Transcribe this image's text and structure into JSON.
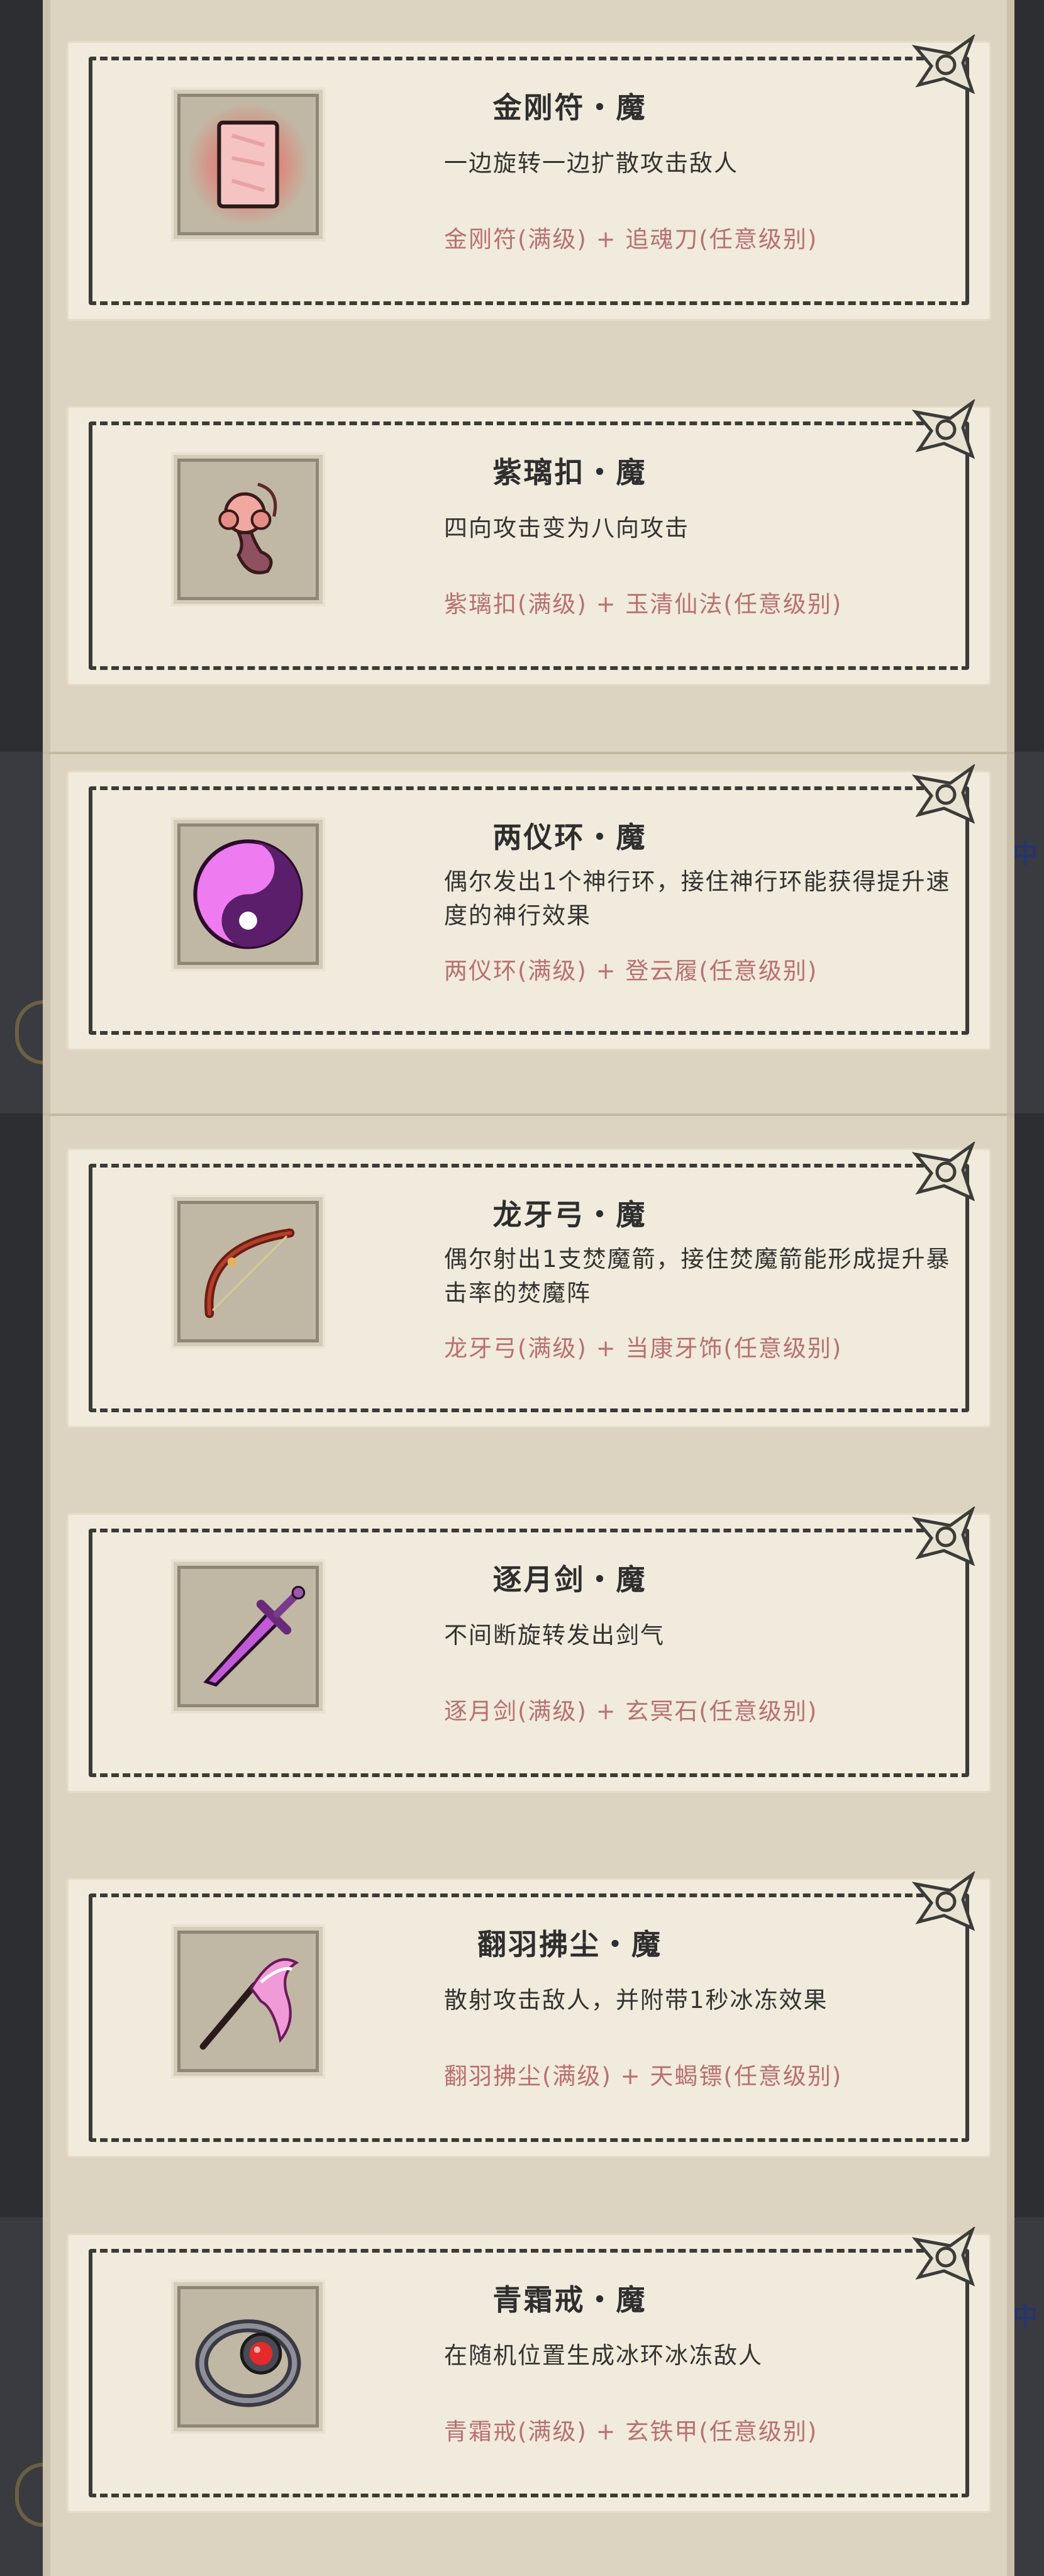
{
  "items": [
    {
      "title": "金刚符・魔",
      "desc": "一边旋转一边扩散攻击敌人",
      "recipe": "金刚符(满级) + 追魂刀(任意级别)",
      "icon": "talisman-icon"
    },
    {
      "title": "紫璃扣・魔",
      "desc": "四向攻击变为八向攻击",
      "recipe": "紫璃扣(满级) + 玉清仙法(任意级别)",
      "icon": "jade-pendant-icon"
    },
    {
      "title": "两仪环・魔",
      "desc": "偶尔发出1个神行环，接住神行环能获得提升速度的神行效果",
      "recipe": "两仪环(满级) + 登云履(任意级别)",
      "icon": "yin-yang-icon"
    },
    {
      "title": "龙牙弓・魔",
      "desc": "偶尔射出1支焚魔箭，接住焚魔箭能形成提升暴击率的焚魔阵",
      "recipe": "龙牙弓(满级) + 当康牙饰(任意级别)",
      "icon": "bow-icon"
    },
    {
      "title": "逐月剑・魔",
      "desc": "不间断旋转发出剑气",
      "recipe": "逐月剑(满级) + 玄冥石(任意级别)",
      "icon": "sword-icon"
    },
    {
      "title": "翻羽拂尘・魔",
      "desc": "散射攻击敌人，并附带1秒冰冻效果",
      "recipe": "翻羽拂尘(满级) + 天蝎镖(任意级别)",
      "icon": "whisk-icon"
    },
    {
      "title": "青霜戒・魔",
      "desc": "在随机位置生成冰环冰冻敌人",
      "recipe": "青霜戒(满级) + 玄铁甲(任意级别)",
      "icon": "ring-icon"
    }
  ],
  "side_glyphs": [
    "中",
    "中"
  ]
}
